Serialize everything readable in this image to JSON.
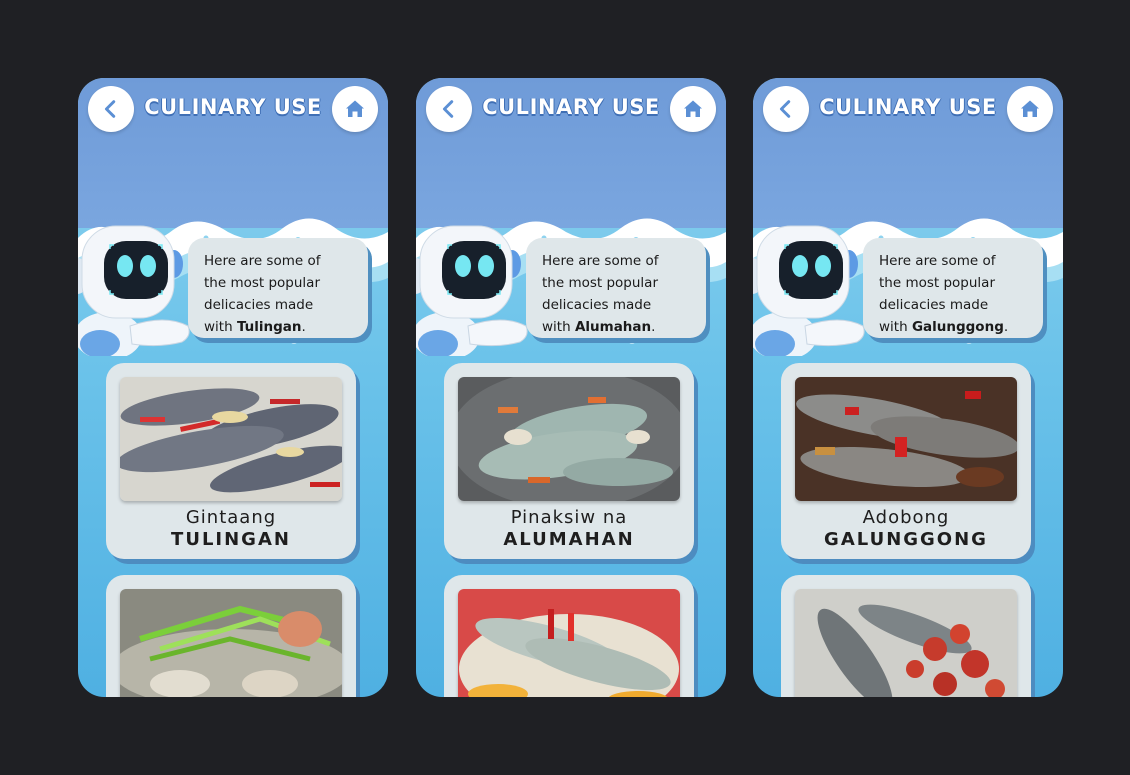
{
  "screens": [
    {
      "header": {
        "title": "CULINARY USE",
        "back_icon": "chevron-left-icon",
        "home_icon": "home-icon"
      },
      "intro": {
        "line1": "Here are some of",
        "line2": "the most popular",
        "line3": "delicacies made",
        "line4_prefix": "with ",
        "fish": "Tulingan",
        "suffix": "."
      },
      "dishes": [
        {
          "sub": "Gintaang",
          "name": "TULINGAN",
          "photo": "gintaang-tulingan-photo"
        },
        {
          "photo": "sinigang-photo"
        }
      ]
    },
    {
      "header": {
        "title": "CULINARY USE",
        "back_icon": "chevron-left-icon",
        "home_icon": "home-icon"
      },
      "intro": {
        "line1": "Here are some of",
        "line2": "the most popular",
        "line3": "delicacies made",
        "line4_prefix": "with ",
        "fish": "Alumahan",
        "suffix": "."
      },
      "dishes": [
        {
          "sub": "Pinaksiw na",
          "name": "ALUMAHAN",
          "photo": "pinaksiw-alumahan-photo"
        },
        {
          "photo": "escabeche-photo"
        }
      ]
    },
    {
      "header": {
        "title": "CULINARY USE",
        "back_icon": "chevron-left-icon",
        "home_icon": "home-icon"
      },
      "intro": {
        "line1": "Here are some of",
        "line2": "the most popular",
        "line3": "delicacies made",
        "line4_prefix": "with ",
        "fish": "Galunggong",
        "suffix": "."
      },
      "dishes": [
        {
          "sub": "Adobong",
          "name": "GALUNGGONG",
          "photo": "adobong-galunggong-photo"
        },
        {
          "photo": "tomato-fish-photo"
        }
      ]
    }
  ],
  "colors": {
    "page_bg": "#1f2024",
    "header_band": "#6f9bd8",
    "water": "#6cc3ea",
    "card_bg": "#dfe7ea",
    "card_shadow": "#4d8cc0",
    "accent_icon": "#5b8fd4"
  }
}
